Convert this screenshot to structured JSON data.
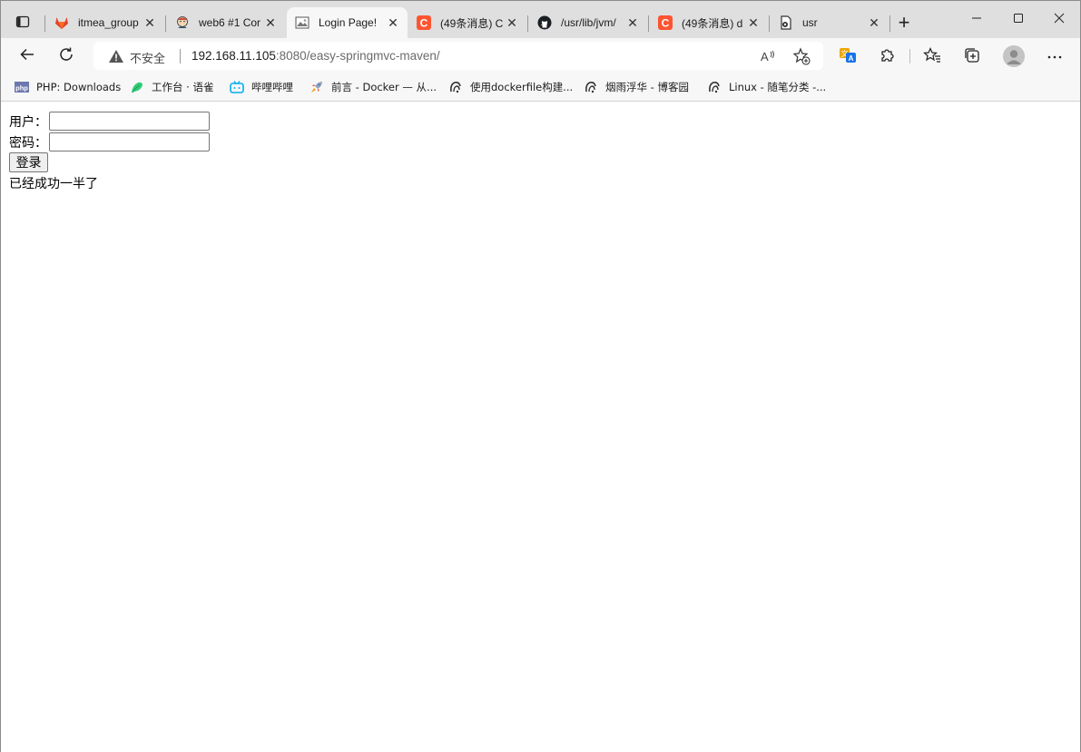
{
  "tabs": [
    {
      "title": "itmea_group",
      "favicon": "gitlab-icon",
      "color": "#e24329"
    },
    {
      "title": "web6 #1 Cor",
      "favicon": "jenkins-icon",
      "color": "#d24939"
    },
    {
      "title": "Login Page!",
      "favicon": "page-image-icon",
      "color": "#555555"
    },
    {
      "title": "(49条消息) C",
      "favicon": "csdn-icon",
      "color": "#fc5531"
    },
    {
      "title": "/usr/lib/jvm/",
      "favicon": "github-icon",
      "color": "#1b1f23"
    },
    {
      "title": "(49条消息) d",
      "favicon": "csdn-icon",
      "color": "#fc5531"
    },
    {
      "title": "usr",
      "favicon": "file-icon",
      "color": "#333333"
    }
  ],
  "active_tab": 2,
  "address": {
    "security_label": "不安全",
    "host": "192.168.11.105",
    "rest": ":8080/easy-springmvc-maven/"
  },
  "bookmarks": [
    {
      "label": "PHP: Downloads",
      "icon": "php-icon"
    },
    {
      "label": "工作台 · 语雀",
      "icon": "yuque-icon"
    },
    {
      "label": "哔哩哔哩",
      "icon": "bilibili-icon"
    },
    {
      "label": "前言 - Docker — 从...",
      "icon": "rocket-icon"
    },
    {
      "label": "使用dockerfile构建...",
      "icon": "cnblogs-icon"
    },
    {
      "label": "烟雨浮华 - 博客园",
      "icon": "cnblogs-icon"
    },
    {
      "label": "Linux - 随笔分类 -...",
      "icon": "cnblogs-icon"
    }
  ],
  "form": {
    "username_label": "用户：",
    "password_label": "密码：",
    "username_value": "",
    "password_value": "",
    "submit_label": "登录"
  },
  "message": "已经成功一半了"
}
